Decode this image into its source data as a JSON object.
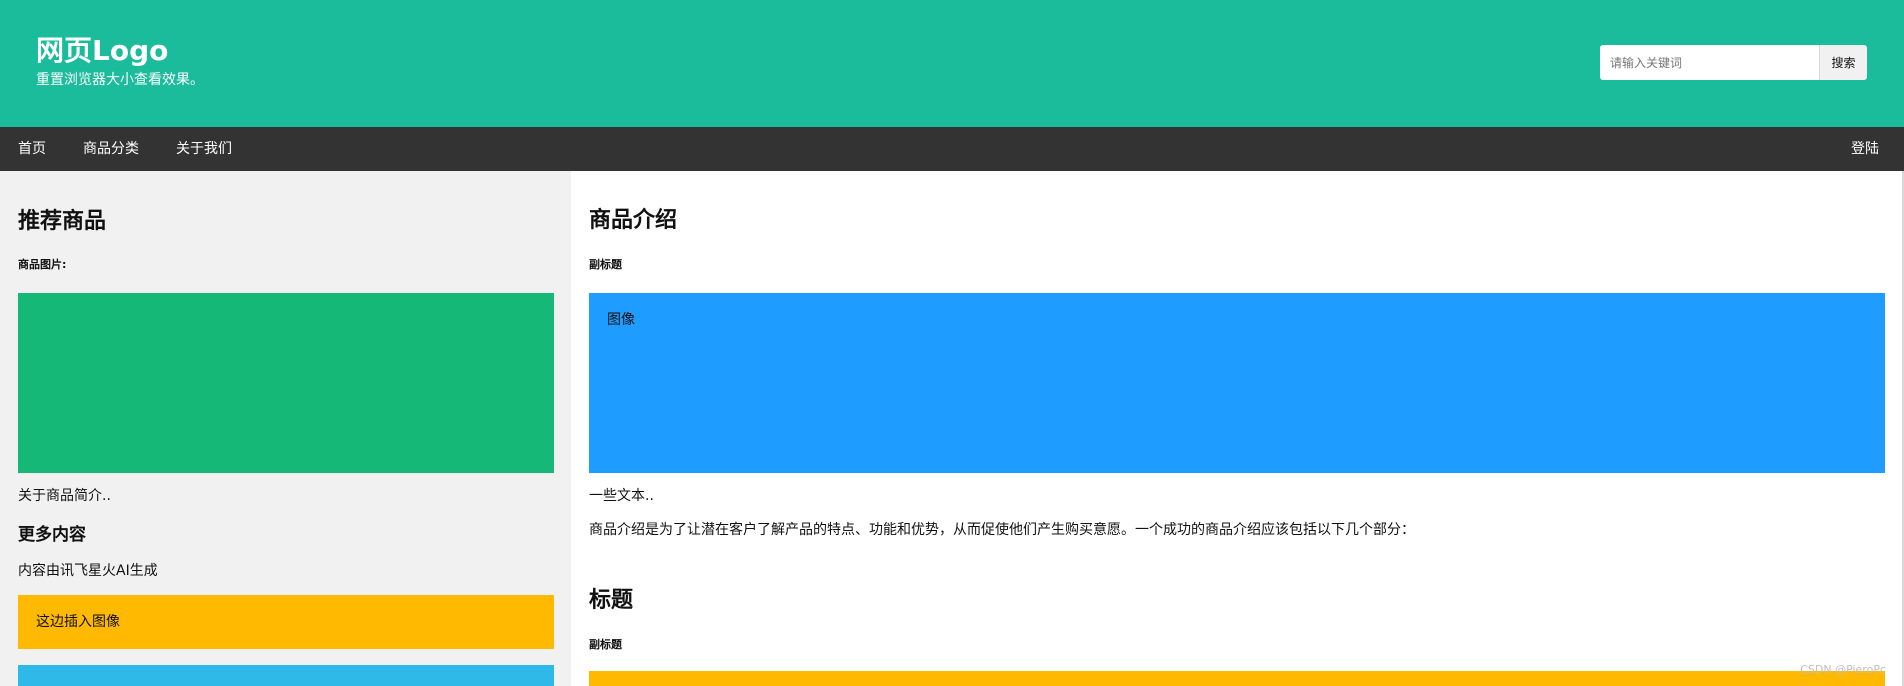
{
  "header": {
    "logo": "网页Logo",
    "tagline": "重置浏览器大小查看效果。",
    "search_placeholder": "请输入关键词",
    "search_button": "搜索",
    "background": "#1abc9c"
  },
  "nav": {
    "items": [
      {
        "label": "首页"
      },
      {
        "label": "商品分类"
      },
      {
        "label": "关于我们"
      }
    ],
    "login": "登陆",
    "background": "#333333"
  },
  "sidebar": {
    "title": "推荐商品",
    "subtitle": "商品图片:",
    "image_color": "#16b877",
    "description": "关于商品简介..",
    "more_title": "更多内容",
    "more_text": "内容由讯飞星火AI生成",
    "image_placeholder": "这边插入图像",
    "yellow_color": "#ffb900",
    "blue_color": "#2fb9e8"
  },
  "main": {
    "title": "商品介绍",
    "subtitle": "副标题",
    "image_label": "图像",
    "image_color": "#1e9cff",
    "text1": "一些文本..",
    "text2": "商品介绍是为了让潜在客户了解产品的特点、功能和优势，从而促使他们产生购买意愿。一个成功的商品介绍应该包括以下几个部分：",
    "section_title": "标题",
    "section_subtitle": "副标题",
    "bottom_color": "#ffb900"
  },
  "watermark": "CSDN @PieroPc",
  "icons": {
    "search_button_icon": "search-icon"
  }
}
